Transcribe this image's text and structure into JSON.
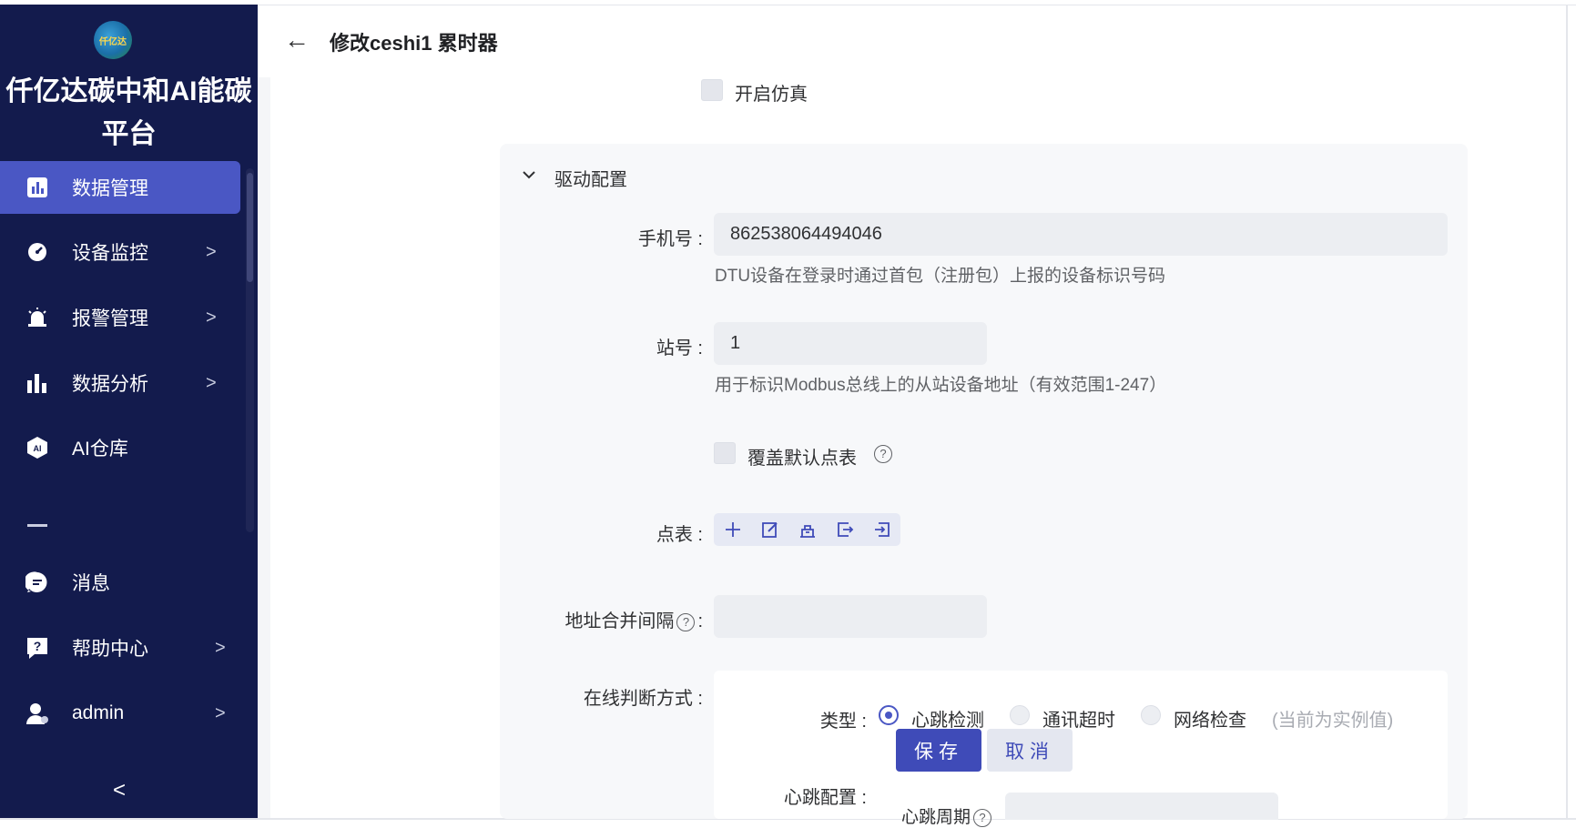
{
  "app": {
    "brand_line1": "仟亿达碳中和AI能碳",
    "brand_line2": "平台",
    "logo_text": "仟亿达"
  },
  "sidebar": {
    "items": [
      {
        "label": "数据管理",
        "icon": "bar-chart-icon",
        "active": true
      },
      {
        "label": "设备监控",
        "icon": "gauge-icon",
        "has_arrow": true
      },
      {
        "label": "报警管理",
        "icon": "alarm-icon",
        "has_arrow": true
      },
      {
        "label": "数据分析",
        "icon": "analytics-icon",
        "has_arrow": true
      },
      {
        "label": "AI仓库",
        "icon": "ai-icon"
      },
      {
        "label": "消息",
        "icon": "message-icon"
      },
      {
        "label": "帮助中心",
        "icon": "help-icon",
        "has_arrow": true
      },
      {
        "label": "admin",
        "icon": "user-icon",
        "has_arrow": true
      }
    ],
    "collapse_glyph": "<",
    "arrow_glyph": ">"
  },
  "header": {
    "back_glyph": "←",
    "title": "修改ceshi1 累时器"
  },
  "form": {
    "simulation_label": "开启仿真",
    "driver_section": "驱动配置",
    "phone_label": "手机号 :",
    "phone_value": "862538064494046",
    "phone_hint": "DTU设备在登录时通过首包（注册包）上报的设备标识号码",
    "station_label": "站号 :",
    "station_value": "1",
    "station_hint": "用于标识Modbus总线上的从站设备地址（有效范围1-247）",
    "override_label": "覆盖默认点表",
    "points_label": "点表 :",
    "merge_label": "地址合并间隔",
    "merge_colon": ":",
    "online_label": "在线判断方式 :",
    "type_label": "类型 :",
    "radio_options": [
      "心跳检测",
      "通讯超时",
      "网络检查"
    ],
    "radio_selected": 0,
    "radio_note": "(当前为实例值)",
    "heartbeat_label": "心跳配置 :",
    "heartbeat_period_label": "心跳周期"
  },
  "buttons": {
    "save": "保存",
    "cancel": "取消"
  },
  "colors": {
    "sidebar_bg": "#131b4d",
    "accent": "#4a57c4",
    "primary_button": "#3f4bb8"
  }
}
